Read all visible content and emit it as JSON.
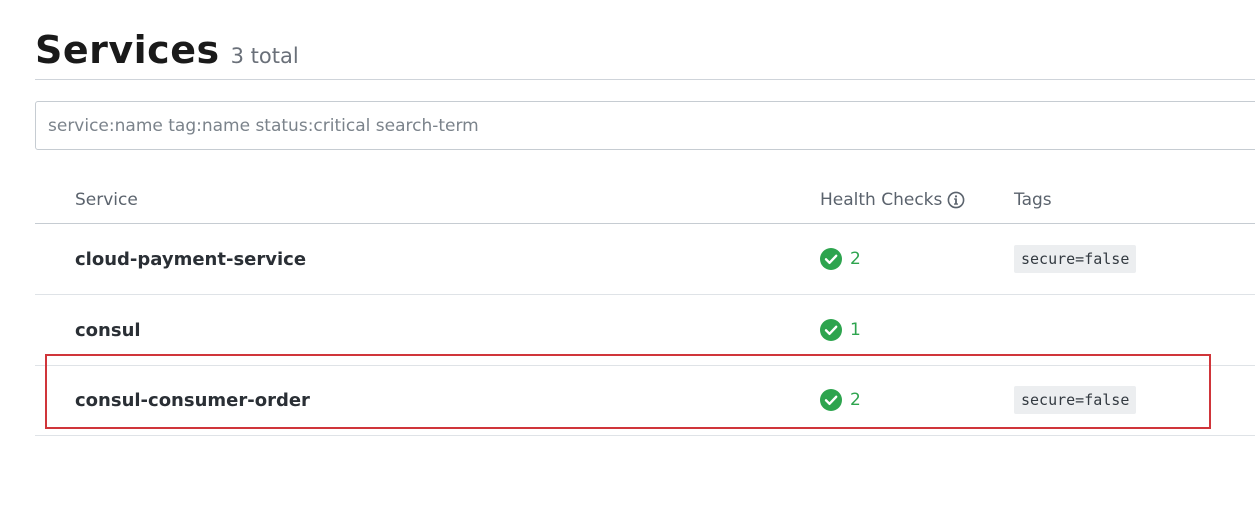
{
  "header": {
    "title": "Services",
    "count_label": "3 total"
  },
  "search": {
    "placeholder": "service:name tag:name status:critical search-term",
    "value": ""
  },
  "table": {
    "columns": {
      "service": "Service",
      "health": "Health Checks",
      "tags": "Tags"
    },
    "rows": [
      {
        "name": "cloud-payment-service",
        "health_passing": "2",
        "tag": "secure=false"
      },
      {
        "name": "consul",
        "health_passing": "1",
        "tag": ""
      },
      {
        "name": "consul-consumer-order",
        "health_passing": "2",
        "tag": "secure=false"
      }
    ]
  },
  "colors": {
    "passing": "#2da44e",
    "highlight_border": "#d0353a"
  },
  "icons": {
    "health_info": "info-circle-icon",
    "passing": "check-circle-icon"
  }
}
